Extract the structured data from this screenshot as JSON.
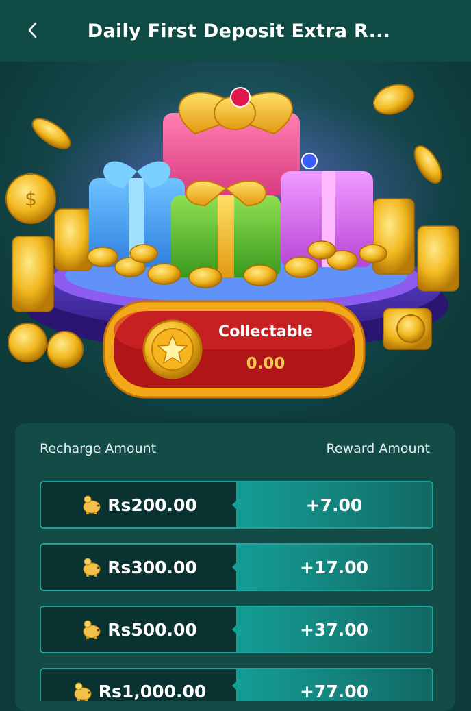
{
  "header": {
    "title": "Daily First Deposit Extra R...",
    "back_icon": "chevron-left-icon"
  },
  "collectable": {
    "label": "Collectable",
    "value": "0.00",
    "icon": "star-coin-icon"
  },
  "table": {
    "recharge_header": "Recharge Amount",
    "reward_header": "Reward Amount",
    "rows": [
      {
        "recharge": "Rs200.00",
        "reward": "+7.00"
      },
      {
        "recharge": "Rs300.00",
        "reward": "+17.00"
      },
      {
        "recharge": "Rs500.00",
        "reward": "+37.00"
      },
      {
        "recharge": "Rs1,000.00",
        "reward": "+77.00"
      }
    ],
    "row_icon": "piggy-bank-icon"
  },
  "colors": {
    "header_bg": "#0f4a45",
    "page_bg": "#0d3b39",
    "accent_teal": "#139e95",
    "gold": "#f5c84a",
    "pill_red": "#8a0f12"
  }
}
